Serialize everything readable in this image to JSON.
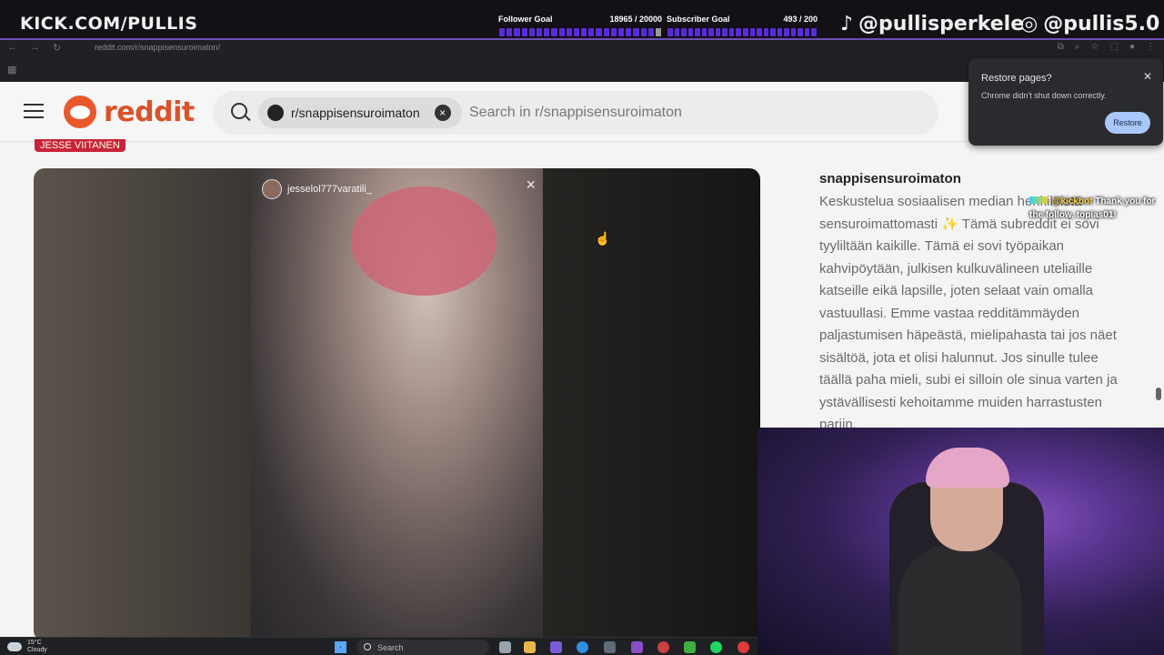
{
  "overlay": {
    "channel": "KICK.COM/PULLIS",
    "follower_goal": {
      "label": "Follower Goal",
      "progress": "18965 / 20000",
      "fraction": 0.948
    },
    "subscriber_goal": {
      "label": "Subscriber Goal",
      "progress": "493 / 200",
      "fraction": 1.0
    },
    "tiktok_handle": "@pullisperkele",
    "instagram_handle": "@pullis5.0",
    "colors": {
      "goal_fill": "#5a2bd8",
      "goal_empty": "#9a9a9a"
    }
  },
  "chrome": {
    "url": "reddit.com/r/snappisensuroimaton/",
    "icons": [
      "back-icon",
      "forward-icon",
      "reload-icon",
      "apps-icon"
    ]
  },
  "reddit": {
    "logo_text": "reddit",
    "search": {
      "subreddit_chip": "r/snappisensuroimaton",
      "placeholder": "Search in r/snappisensuroimaton"
    },
    "post": {
      "flair": "JESSE VIITANEN",
      "media_username": "jesselol777varatili_"
    },
    "sidebar": {
      "title": "snappisensuroimaton",
      "description": "Keskustelua sosiaalisen median henkilöistä sensuroimattomasti ✨ Tämä subreddit ei sovi tyyliltään kaikille. Tämä ei sovi työpaikan kahvipöytään, julkisen kulkuvälineen uteliaille katseille eikä lapsille, joten selaat vain omalla vastuullasi. Emme vastaa redditämmäyden paljastumisen häpeästä, mielipahasta tai jos näet sisältöä, jota et olisi halunnut. Jos sinulle tulee täällä paha mieli, subi ei silloin ole sinua varten ja ystävällisesti kehoitamme muiden harrastusten pariin."
    }
  },
  "restore_popup": {
    "title": "Restore pages?",
    "message": "Chrome didn't shut down correctly.",
    "button": "Restore"
  },
  "chat_alert": {
    "user": "@kickbot",
    "message": "Thank you for the follow, topias01!"
  },
  "taskbar": {
    "temperature": "15°C",
    "condition": "Cloudy",
    "search_label": "Search"
  }
}
